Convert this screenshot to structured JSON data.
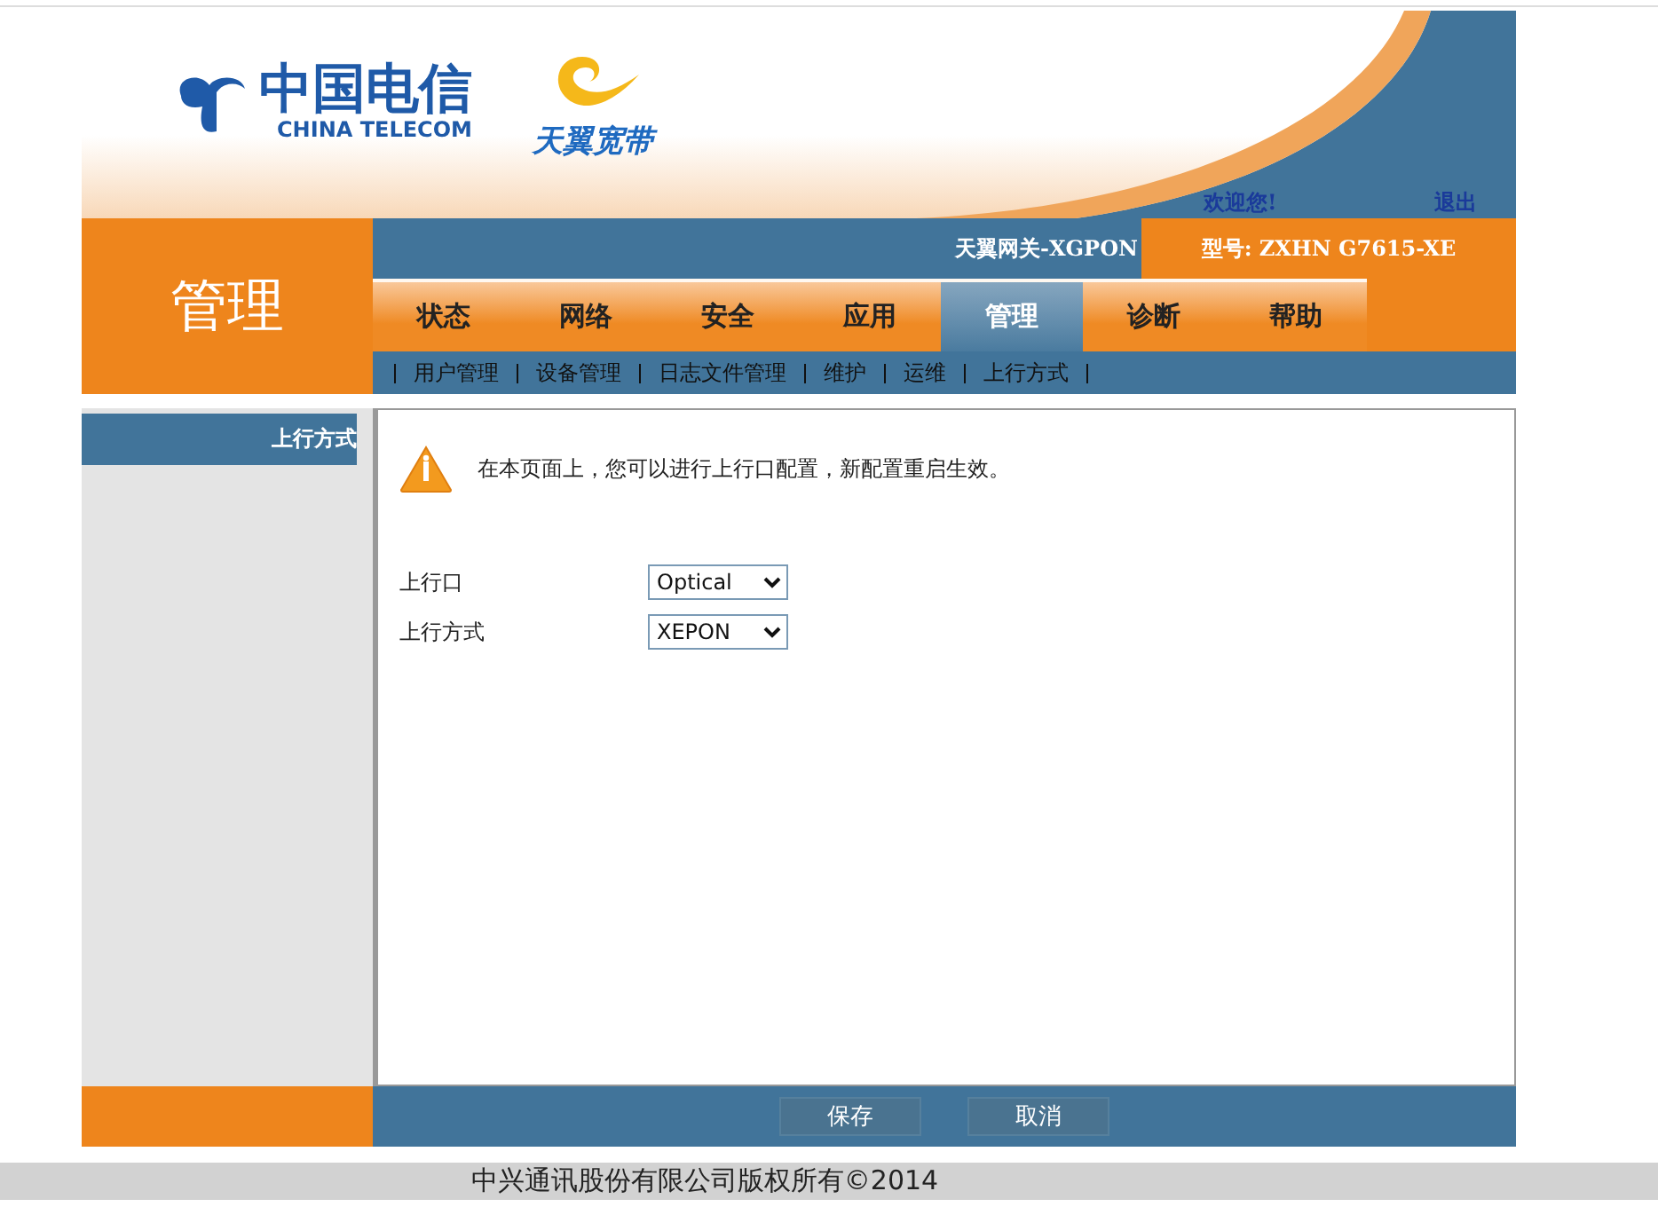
{
  "header": {
    "logo_cn": "中国电信",
    "logo_en": "CHINA TELECOM",
    "brand": "天翼宽带",
    "welcome": "欢迎您!",
    "logout": "退出"
  },
  "left_title": "管理",
  "gateway": "天翼网关-XGPON",
  "model": "型号: ZXHN G7615-XE",
  "tabs": [
    {
      "label": "状态",
      "selected": false
    },
    {
      "label": "网络",
      "selected": false
    },
    {
      "label": "安全",
      "selected": false
    },
    {
      "label": "应用",
      "selected": false
    },
    {
      "label": "管理",
      "selected": true
    },
    {
      "label": "诊断",
      "selected": false
    },
    {
      "label": "帮助",
      "selected": false
    }
  ],
  "subnav": [
    "用户管理",
    "设备管理",
    "日志文件管理",
    "维护",
    "运维",
    "上行方式"
  ],
  "sidebar": {
    "items": [
      {
        "label": "上行方式",
        "selected": true
      }
    ]
  },
  "notice": "在本页面上，您可以进行上行口配置，新配置重启生效。",
  "fields": [
    {
      "label": "上行口",
      "value": "Optical"
    },
    {
      "label": "上行方式",
      "value": "XEPON"
    }
  ],
  "buttons": [
    "保存",
    "取消"
  ],
  "footer": "中兴通讯股份有限公司版权所有©2014"
}
